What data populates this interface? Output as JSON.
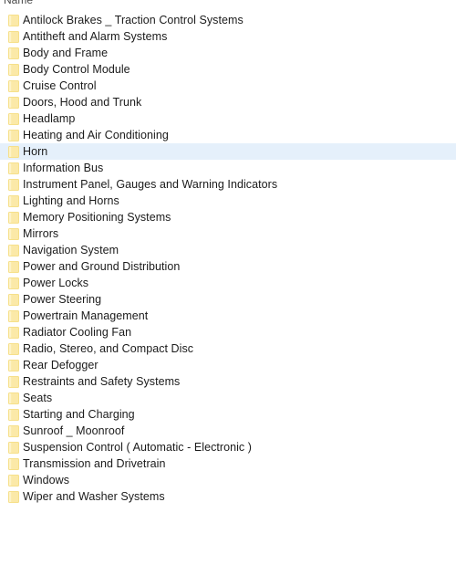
{
  "header": {
    "column_name": "Name"
  },
  "colors": {
    "selection_background": "#e5f0fb",
    "folder_icon_fill": "#fbe9a8",
    "folder_icon_edge": "#f6e08a",
    "text": "#1b1b1b",
    "background": "#ffffff"
  },
  "files": [
    {
      "name": "Antilock Brakes _ Traction Control Systems",
      "icon": "folder-icon",
      "selected": false
    },
    {
      "name": "Antitheft and Alarm Systems",
      "icon": "folder-icon",
      "selected": false
    },
    {
      "name": "Body and Frame",
      "icon": "folder-icon",
      "selected": false
    },
    {
      "name": "Body Control Module",
      "icon": "folder-icon",
      "selected": false
    },
    {
      "name": "Cruise Control",
      "icon": "folder-icon",
      "selected": false
    },
    {
      "name": "Doors, Hood and Trunk",
      "icon": "folder-icon",
      "selected": false
    },
    {
      "name": "Headlamp",
      "icon": "folder-icon",
      "selected": false
    },
    {
      "name": "Heating and Air Conditioning",
      "icon": "folder-icon",
      "selected": false
    },
    {
      "name": "Horn",
      "icon": "folder-icon",
      "selected": true
    },
    {
      "name": "Information Bus",
      "icon": "folder-icon",
      "selected": false
    },
    {
      "name": "Instrument Panel, Gauges and Warning Indicators",
      "icon": "folder-icon",
      "selected": false
    },
    {
      "name": "Lighting and Horns",
      "icon": "folder-icon",
      "selected": false
    },
    {
      "name": "Memory Positioning Systems",
      "icon": "folder-icon",
      "selected": false
    },
    {
      "name": "Mirrors",
      "icon": "folder-icon",
      "selected": false
    },
    {
      "name": "Navigation System",
      "icon": "folder-icon",
      "selected": false
    },
    {
      "name": "Power and Ground Distribution",
      "icon": "folder-icon",
      "selected": false
    },
    {
      "name": "Power Locks",
      "icon": "folder-icon",
      "selected": false
    },
    {
      "name": "Power Steering",
      "icon": "folder-icon",
      "selected": false
    },
    {
      "name": "Powertrain Management",
      "icon": "folder-icon",
      "selected": false
    },
    {
      "name": "Radiator Cooling Fan",
      "icon": "folder-icon",
      "selected": false
    },
    {
      "name": "Radio, Stereo, and Compact Disc",
      "icon": "folder-icon",
      "selected": false
    },
    {
      "name": "Rear Defogger",
      "icon": "folder-icon",
      "selected": false
    },
    {
      "name": "Restraints and Safety Systems",
      "icon": "folder-icon",
      "selected": false
    },
    {
      "name": "Seats",
      "icon": "folder-icon",
      "selected": false
    },
    {
      "name": "Starting and Charging",
      "icon": "folder-icon",
      "selected": false
    },
    {
      "name": "Sunroof _ Moonroof",
      "icon": "folder-icon",
      "selected": false
    },
    {
      "name": "Suspension Control ( Automatic - Electronic )",
      "icon": "folder-icon",
      "selected": false
    },
    {
      "name": "Transmission and Drivetrain",
      "icon": "folder-icon",
      "selected": false
    },
    {
      "name": "Windows",
      "icon": "folder-icon",
      "selected": false
    },
    {
      "name": "Wiper and Washer Systems",
      "icon": "folder-icon",
      "selected": false
    }
  ]
}
